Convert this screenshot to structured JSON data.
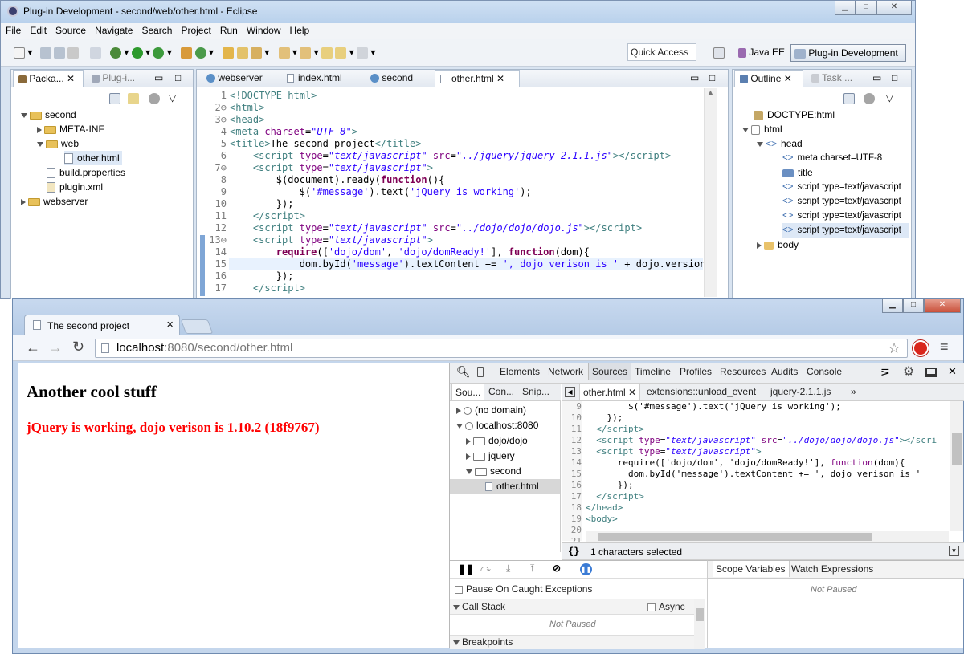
{
  "eclipse": {
    "window_title": "Plug-in Development - second/web/other.html - Eclipse",
    "menu": [
      "File",
      "Edit",
      "Source",
      "Navigate",
      "Search",
      "Project",
      "Run",
      "Window",
      "Help"
    ],
    "quick_access": "Quick Access",
    "perspectives": {
      "java_ee": "Java EE",
      "plugin_dev": "Plug-in Development"
    },
    "left_tabs": {
      "package": "Packa...",
      "plugin": "Plug-i..."
    },
    "tree": {
      "second": "second",
      "meta_inf": "META-INF",
      "web": "web",
      "other_html": "other.html",
      "build_properties": "build.properties",
      "plugin_xml": "plugin.xml",
      "webserver": "webserver"
    },
    "editor_tabs": [
      "webserver",
      "index.html",
      "second",
      "other.html"
    ],
    "code_lines": [
      {
        "n": "1",
        "html": "<span class='tg'>&lt;!DOCTYPE html&gt;</span>"
      },
      {
        "n": "2⊖",
        "html": "<span class='tg'>&lt;html&gt;</span>"
      },
      {
        "n": "3⊖",
        "html": "<span class='tg'>&lt;head&gt;</span>"
      },
      {
        "n": "4",
        "html": "<span class='tg'>&lt;meta</span> <span class='at'>charset</span>=<span class='av'>\"UTF-8\"</span><span class='tg'>&gt;</span>"
      },
      {
        "n": "5",
        "html": "<span class='tg'>&lt;title&gt;</span>The second project<span class='tg'>&lt;/title&gt;</span>"
      },
      {
        "n": "6",
        "html": "    <span class='tg'>&lt;script</span> <span class='at'>type</span>=<span class='av'>\"text/javascript\"</span> <span class='at'>src</span>=<span class='av'>\"../jquery/jquery-2.1.1.js\"</span><span class='tg'>&gt;&lt;/script&gt;</span>"
      },
      {
        "n": "7⊖",
        "html": "    <span class='tg'>&lt;script</span> <span class='at'>type</span>=<span class='av'>\"text/javascript\"</span><span class='tg'>&gt;</span>"
      },
      {
        "n": "8",
        "html": "        $(document).ready(<span class='kw'>function</span>(){"
      },
      {
        "n": "9",
        "html": "            $(<span class='st'>'#message'</span>).text(<span class='st'>'jQuery is working'</span>);"
      },
      {
        "n": "10",
        "html": "        });"
      },
      {
        "n": "11",
        "html": "    <span class='tg'>&lt;/script&gt;</span>"
      },
      {
        "n": "12",
        "html": "    <span class='tg'>&lt;script</span> <span class='at'>type</span>=<span class='av'>\"text/javascript\"</span> <span class='at'>src</span>=<span class='av'>\"../dojo/dojo/dojo.js\"</span><span class='tg'>&gt;&lt;/script&gt;</span>"
      },
      {
        "n": "13⊖",
        "html": "    <span class='tg'>&lt;script</span> <span class='at'>type</span>=<span class='av'>\"text/javascript\"</span><span class='tg'>&gt;</span>"
      },
      {
        "n": "14",
        "html": "        <span class='kw'>require</span>([<span class='st'>'dojo/dom'</span>, <span class='st'>'dojo/domReady!'</span>], <span class='kw'>function</span>(dom){"
      },
      {
        "n": "15",
        "html": "            dom.byId(<span class='st'>'message'</span>).textContent += <span class='st'>', dojo verison is '</span> + dojo.version;"
      },
      {
        "n": "16",
        "html": "        });"
      },
      {
        "n": "17",
        "html": "    <span class='tg'>&lt;/script&gt;</span>"
      }
    ],
    "outline_tabs": {
      "outline": "Outline",
      "task": "Task ..."
    },
    "outline": {
      "doctype": "DOCTYPE:html",
      "html": "html",
      "head": "head",
      "meta": "meta charset=UTF-8",
      "title": "title",
      "script1": "script type=text/javascript",
      "script2": "script type=text/javascript",
      "script3": "script type=text/javascript",
      "script4": "script type=text/javascript",
      "body": "body"
    }
  },
  "browser": {
    "tab_title": "The second project",
    "url_host": "localhost",
    "url_rest": ":8080/second/other.html",
    "page_heading": "Another cool stuff",
    "page_message": "jQuery is working, dojo verison is 1.10.2 (18f9767)"
  },
  "devtools": {
    "tabs": [
      "Elements",
      "Network",
      "Sources",
      "Timeline",
      "Profiles",
      "Resources",
      "Audits",
      "Console"
    ],
    "nav_tabs": [
      "Sou...",
      "Con...",
      "Snip..."
    ],
    "file_tabs": [
      "other.html",
      "extensions::unload_event",
      "jquery-2.1.1.js"
    ],
    "more": "»",
    "tree": {
      "no_domain": "(no domain)",
      "localhost": "localhost:8080",
      "dojo": "dojo/dojo",
      "jquery": "jquery",
      "second": "second",
      "other": "other.html"
    },
    "code_lines": [
      {
        "n": "9",
        "html": "        $('#message').text('jQuery is working');"
      },
      {
        "n": "10",
        "html": "    });"
      },
      {
        "n": "11",
        "html": "  <span class='tg'>&lt;/script&gt;</span>"
      },
      {
        "n": "12",
        "html": "  <span class='tg'>&lt;script</span> <span class='at'>type</span>=<span class='av'>\"text/javascript\"</span> <span class='at'>src</span>=<span class='av'>\"../dojo/dojo/dojo.js\"</span><span class='tg'>&gt;&lt;/scri</span>"
      },
      {
        "n": "13",
        "html": "  <span class='tg'>&lt;script</span> <span class='at'>type</span>=<span class='av'>\"text/javascript\"</span><span class='tg'>&gt;</span>"
      },
      {
        "n": "14",
        "html": "      require(['dojo/dom', 'dojo/domReady!'], <span class='at'>function</span>(dom){"
      },
      {
        "n": "15",
        "html": "        dom.byId('message').textContent += ', dojo verison is '"
      },
      {
        "n": "16",
        "html": "      });"
      },
      {
        "n": "17",
        "html": "  <span class='tg'>&lt;/script&gt;</span>"
      },
      {
        "n": "18",
        "html": "<span class='tg'>&lt;/head&gt;</span>"
      },
      {
        "n": "19",
        "html": "<span class='tg'>&lt;body&gt;</span>"
      },
      {
        "n": "20",
        "html": ""
      },
      {
        "n": "21",
        "html": ""
      }
    ],
    "status": "1 characters selected",
    "pause_exceptions": "Pause On Caught Exceptions",
    "call_stack": "Call Stack",
    "async": "Async",
    "not_paused": "Not Paused",
    "breakpoints": "Breakpoints",
    "scope_variables": "Scope Variables",
    "watch_expressions": "Watch Expressions",
    "scope_not_paused": "Not Paused"
  },
  "colors": {
    "accent": "#3875d7",
    "message_red": "#ff0000"
  }
}
